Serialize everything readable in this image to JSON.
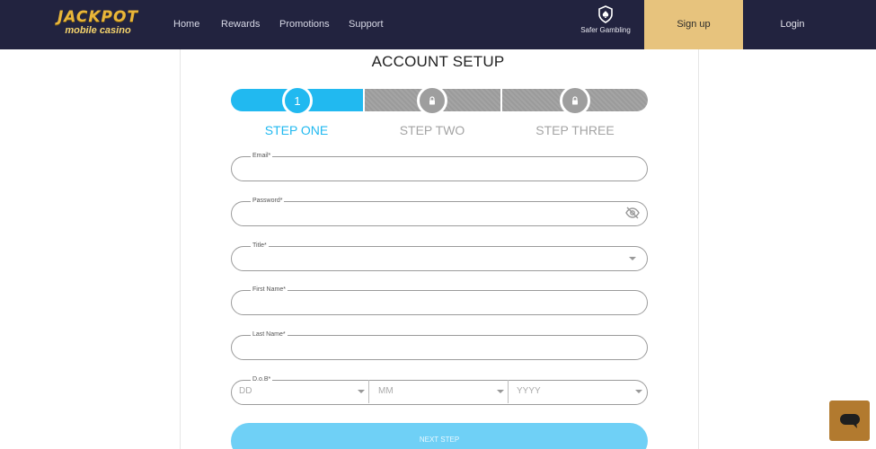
{
  "header": {
    "logo_top": "JACKPOT",
    "logo_bottom": "mobile casino",
    "nav": [
      "Home",
      "Rewards",
      "Promotions",
      "Support"
    ],
    "safer_gambling": "Safer Gambling",
    "signup": "Sign up",
    "login": "Login"
  },
  "form": {
    "title": "ACCOUNT SETUP",
    "steps": [
      {
        "label": "STEP ONE",
        "number": "1"
      },
      {
        "label": "STEP TWO"
      },
      {
        "label": "STEP THREE"
      }
    ],
    "fields": {
      "email": "Email*",
      "password": "Password*",
      "title": "Title*",
      "first_name": "First Name*",
      "last_name": "Last Name*",
      "dob": "D.o.B*"
    },
    "dob_placeholders": {
      "day": "DD",
      "month": "MM",
      "year": "YYYY"
    },
    "next_step": "NEXT STEP"
  },
  "colors": {
    "header_bg": "#22233f",
    "signup_bg": "#e7c37d",
    "accent": "#21b9f0",
    "chat_bg": "#b27a2f"
  }
}
